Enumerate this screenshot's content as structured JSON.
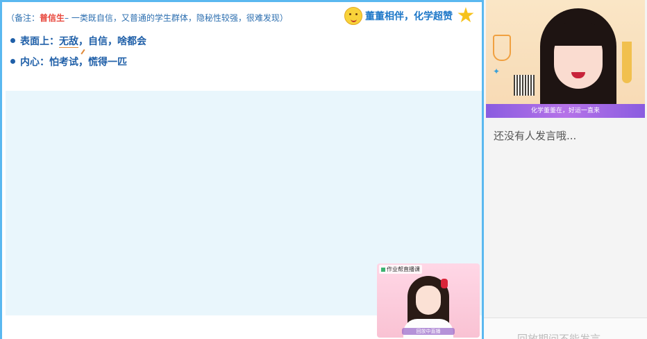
{
  "slide": {
    "note_prefix": "（备注：",
    "note_highlight": "普信生",
    "note_rest": "– 一类既自信，又普通的学生群体，隐秘性较强，很难发现）",
    "slogan": "董董相伴，化学超赞",
    "bullets": [
      {
        "prefix": "表面上：",
        "underlined": "无敌",
        "rest": "，自信，啥都会"
      },
      {
        "prefix": "内心：",
        "underlined": "",
        "rest": "怕考试，慌得一匹"
      }
    ]
  },
  "pip": {
    "label": "作业帮直播课",
    "name_tag": "回放中直播"
  },
  "teacher_cam": {
    "caption": "化学董董在，好运一直来"
  },
  "chat": {
    "empty_text": "还没有人发言哦...",
    "disabled_text": "回放期间不能发言"
  },
  "colors": {
    "slide_border": "#5ab8f0",
    "slide_body_bg": "#e9f6fc",
    "text_blue": "#1f5fa8",
    "highlight_red": "#e8473c",
    "caption_purple": "#8a5ce0"
  },
  "icons": [
    "face-emoji-icon",
    "star-icon",
    "bullet-dot-icon"
  ]
}
